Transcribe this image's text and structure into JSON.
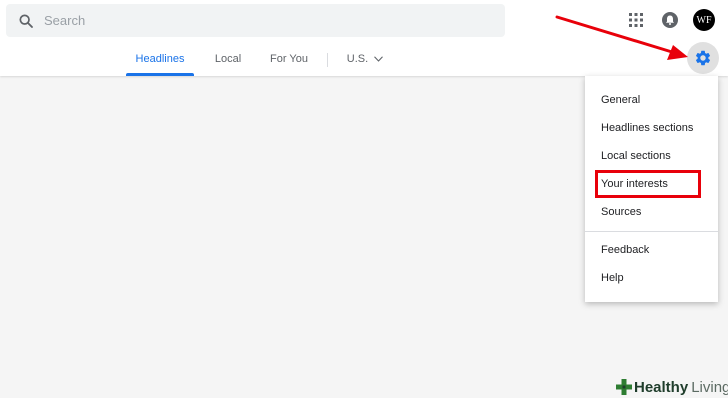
{
  "search": {
    "placeholder": "Search"
  },
  "header": {
    "avatar_initials": "WF",
    "icons": {
      "search": "search-icon",
      "apps": "apps-grid-icon",
      "notifications": "bell-icon",
      "settings": "gear-icon"
    }
  },
  "tabs": [
    {
      "label": "Headlines",
      "active": true
    },
    {
      "label": "Local",
      "active": false
    },
    {
      "label": "For You",
      "active": false
    },
    {
      "label": "U.S.",
      "active": false
    }
  ],
  "settings_menu": {
    "items": [
      {
        "label": "General"
      },
      {
        "label": "Headlines sections"
      },
      {
        "label": "Local sections"
      },
      {
        "label": "Your interests",
        "highlighted": true
      },
      {
        "label": "Sources"
      },
      {
        "label": "Feedback"
      },
      {
        "label": "Help"
      }
    ]
  },
  "colors": {
    "accent": "#1a73e8",
    "annotation": "#e8000a",
    "background": "#f5f5f5"
  },
  "watermark": {
    "part1": "Healthy",
    "part2": "Living"
  }
}
